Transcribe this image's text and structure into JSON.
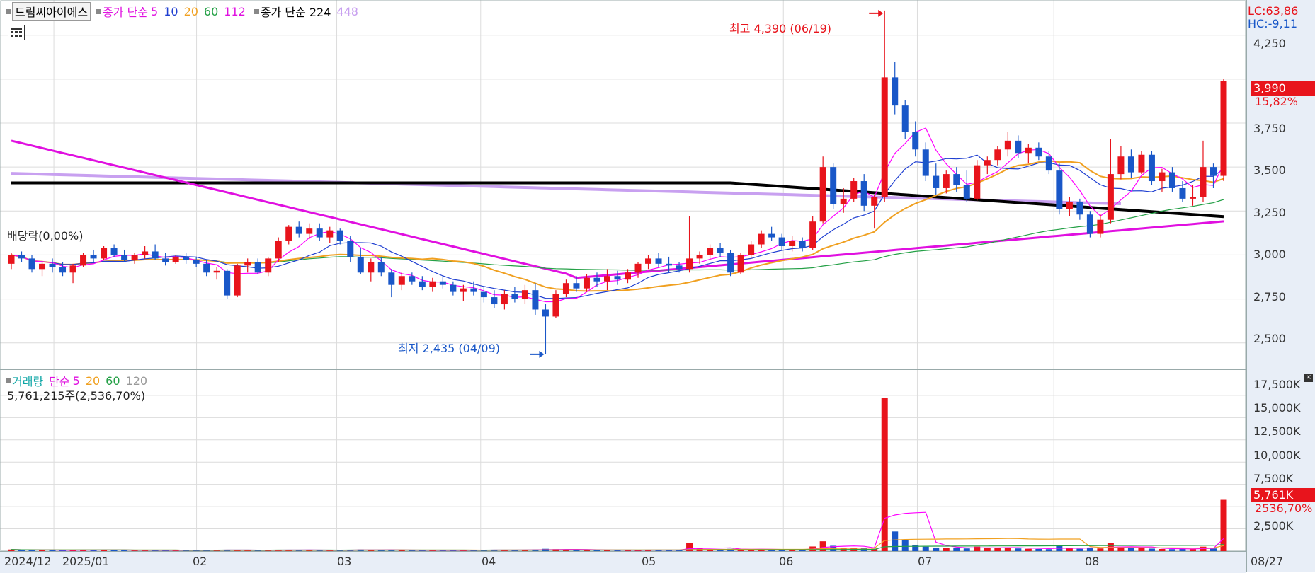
{
  "header": {
    "stock_name": "드림씨아이에스",
    "ma_label": "종가 단순",
    "ma_periods": [
      "5",
      "10",
      "20",
      "60",
      "112"
    ],
    "ma2_label": "종가 단순 224",
    "ma2_extra": "448",
    "lc": "LC:63,86",
    "hc": "HC:-9,11"
  },
  "annotations": {
    "high": "최고 4,390 (06/19)",
    "low": "최저 2,435 (04/09)",
    "dividend": "배당락(0,00%)",
    "price_tag": "3,990",
    "price_change": "15,82%",
    "volume_text": "5,761,215주(2,536,70%)",
    "vol_tag": "5,761K",
    "vol_change": "2536,70%"
  },
  "volume_legend": {
    "label": "거래량",
    "ma_label": "단순",
    "periods": [
      "5",
      "20",
      "60",
      "120"
    ]
  },
  "colors": {
    "up": "#e8141c",
    "down": "#1957c8",
    "ma5": "#ff00ff",
    "ma10": "#1f3fd1",
    "ma20": "#f0a020",
    "ma60": "#24a046",
    "ma112": "#e010e0",
    "ma224": "#000000",
    "ma448": "#c8a0f0"
  },
  "chart_data": {
    "type": "candlestick",
    "price_axis": {
      "ticks": [
        "4,250",
        "3,990",
        "3,750",
        "3,500",
        "3,250",
        "3,000",
        "2,750",
        "2,500"
      ],
      "range": [
        2350,
        4450
      ]
    },
    "volume_axis": {
      "ticks": [
        "17,500K",
        "15,000K",
        "12,500K",
        "10,000K",
        "7,500K",
        "5,761K",
        "2,500K"
      ],
      "range": [
        0,
        19000
      ]
    },
    "x_ticks": [
      "2024/12",
      "2025/01",
      "02",
      "03",
      "04",
      "05",
      "06",
      "07",
      "08",
      "08/27"
    ],
    "candles": [
      [
        2950,
        3010,
        2920,
        3000
      ],
      [
        3000,
        3020,
        2960,
        2980
      ],
      [
        2980,
        3000,
        2900,
        2920
      ],
      [
        2920,
        2960,
        2880,
        2950
      ],
      [
        2950,
        2980,
        2900,
        2930
      ],
      [
        2930,
        2960,
        2880,
        2900
      ],
      [
        2900,
        2950,
        2840,
        2940
      ],
      [
        2940,
        3010,
        2930,
        3000
      ],
      [
        3000,
        3030,
        2960,
        2980
      ],
      [
        2980,
        3050,
        2970,
        3040
      ],
      [
        3040,
        3060,
        2990,
        3000
      ],
      [
        3000,
        3030,
        2960,
        2970
      ],
      [
        2970,
        3010,
        2950,
        3000
      ],
      [
        3000,
        3050,
        2980,
        3020
      ],
      [
        3020,
        3060,
        2970,
        2980
      ],
      [
        2980,
        3010,
        2940,
        2960
      ],
      [
        2960,
        3000,
        2950,
        2990
      ],
      [
        2990,
        3010,
        2950,
        2970
      ],
      [
        2970,
        2990,
        2930,
        2950
      ],
      [
        2950,
        2970,
        2880,
        2900
      ],
      [
        2900,
        2930,
        2860,
        2910
      ],
      [
        2910,
        2920,
        2750,
        2770
      ],
      [
        2770,
        2950,
        2760,
        2940
      ],
      [
        2940,
        2980,
        2900,
        2960
      ],
      [
        2960,
        2980,
        2890,
        2900
      ],
      [
        2900,
        2990,
        2880,
        2980
      ],
      [
        2980,
        3100,
        2960,
        3080
      ],
      [
        3080,
        3170,
        3060,
        3160
      ],
      [
        3160,
        3190,
        3100,
        3120
      ],
      [
        3120,
        3180,
        3090,
        3150
      ],
      [
        3150,
        3180,
        3080,
        3100
      ],
      [
        3100,
        3160,
        3070,
        3140
      ],
      [
        3140,
        3150,
        3060,
        3080
      ],
      [
        3080,
        3110,
        2960,
        2990
      ],
      [
        2990,
        3040,
        2890,
        2900
      ],
      [
        2900,
        2980,
        2850,
        2960
      ],
      [
        2960,
        2990,
        2880,
        2900
      ],
      [
        2900,
        2920,
        2760,
        2830
      ],
      [
        2830,
        2900,
        2800,
        2880
      ],
      [
        2880,
        2900,
        2830,
        2850
      ],
      [
        2850,
        2880,
        2800,
        2820
      ],
      [
        2820,
        2870,
        2790,
        2850
      ],
      [
        2850,
        2880,
        2810,
        2830
      ],
      [
        2830,
        2850,
        2770,
        2790
      ],
      [
        2790,
        2830,
        2740,
        2810
      ],
      [
        2810,
        2850,
        2770,
        2790
      ],
      [
        2790,
        2820,
        2730,
        2760
      ],
      [
        2760,
        2800,
        2700,
        2720
      ],
      [
        2720,
        2800,
        2690,
        2780
      ],
      [
        2780,
        2820,
        2730,
        2750
      ],
      [
        2750,
        2830,
        2720,
        2800
      ],
      [
        2800,
        2840,
        2660,
        2690
      ],
      [
        2690,
        2720,
        2435,
        2650
      ],
      [
        2650,
        2800,
        2640,
        2780
      ],
      [
        2780,
        2860,
        2760,
        2840
      ],
      [
        2840,
        2880,
        2790,
        2810
      ],
      [
        2810,
        2890,
        2790,
        2870
      ],
      [
        2870,
        2900,
        2820,
        2850
      ],
      [
        2850,
        2920,
        2800,
        2880
      ],
      [
        2880,
        2910,
        2830,
        2860
      ],
      [
        2860,
        2920,
        2840,
        2900
      ],
      [
        2900,
        2960,
        2870,
        2950
      ],
      [
        2950,
        3000,
        2920,
        2980
      ],
      [
        2980,
        3010,
        2930,
        2950
      ],
      [
        2950,
        2990,
        2900,
        2940
      ],
      [
        2940,
        2960,
        2900,
        2920
      ],
      [
        2920,
        3220,
        2900,
        2980
      ],
      [
        2980,
        3020,
        2950,
        3000
      ],
      [
        3000,
        3060,
        2970,
        3040
      ],
      [
        3040,
        3070,
        2990,
        3010
      ],
      [
        3010,
        3030,
        2880,
        2900
      ],
      [
        2900,
        3010,
        2890,
        3000
      ],
      [
        3000,
        3080,
        2980,
        3060
      ],
      [
        3060,
        3140,
        3040,
        3120
      ],
      [
        3120,
        3160,
        3080,
        3100
      ],
      [
        3100,
        3120,
        3030,
        3050
      ],
      [
        3050,
        3110,
        3020,
        3080
      ],
      [
        3080,
        3100,
        3020,
        3040
      ],
      [
        3040,
        3220,
        3030,
        3190
      ],
      [
        3190,
        3560,
        3180,
        3500
      ],
      [
        3500,
        3520,
        3260,
        3290
      ],
      [
        3290,
        3380,
        3240,
        3320
      ],
      [
        3320,
        3440,
        3300,
        3420
      ],
      [
        3420,
        3460,
        3250,
        3280
      ],
      [
        3280,
        3340,
        3150,
        3330
      ],
      [
        3330,
        4390,
        3300,
        4010
      ],
      [
        4010,
        4100,
        3800,
        3850
      ],
      [
        3850,
        3880,
        3660,
        3700
      ],
      [
        3700,
        3760,
        3560,
        3600
      ],
      [
        3600,
        3640,
        3420,
        3450
      ],
      [
        3450,
        3520,
        3340,
        3380
      ],
      [
        3380,
        3480,
        3350,
        3460
      ],
      [
        3460,
        3500,
        3360,
        3400
      ],
      [
        3400,
        3480,
        3300,
        3320
      ],
      [
        3320,
        3540,
        3310,
        3510
      ],
      [
        3510,
        3560,
        3460,
        3540
      ],
      [
        3540,
        3620,
        3510,
        3600
      ],
      [
        3600,
        3700,
        3560,
        3650
      ],
      [
        3650,
        3680,
        3550,
        3580
      ],
      [
        3580,
        3630,
        3520,
        3610
      ],
      [
        3610,
        3640,
        3540,
        3560
      ],
      [
        3560,
        3590,
        3460,
        3480
      ],
      [
        3480,
        3520,
        3230,
        3260
      ],
      [
        3260,
        3330,
        3220,
        3300
      ],
      [
        3300,
        3320,
        3200,
        3230
      ],
      [
        3230,
        3250,
        3100,
        3120
      ],
      [
        3120,
        3230,
        3100,
        3200
      ],
      [
        3200,
        3660,
        3180,
        3460
      ],
      [
        3460,
        3620,
        3430,
        3560
      ],
      [
        3560,
        3600,
        3440,
        3470
      ],
      [
        3470,
        3590,
        3460,
        3570
      ],
      [
        3570,
        3590,
        3400,
        3420
      ],
      [
        3420,
        3490,
        3360,
        3470
      ],
      [
        3470,
        3500,
        3360,
        3380
      ],
      [
        3380,
        3420,
        3300,
        3320
      ],
      [
        3320,
        3400,
        3280,
        3330
      ],
      [
        3330,
        3650,
        3300,
        3500
      ],
      [
        3500,
        3520,
        3380,
        3450
      ],
      [
        3450,
        4000,
        3420,
        3990
      ]
    ],
    "volumes": [
      180,
      120,
      140,
      100,
      90,
      110,
      130,
      160,
      100,
      150,
      120,
      90,
      100,
      110,
      100,
      90,
      80,
      100,
      90,
      120,
      140,
      160,
      100,
      90,
      80,
      130,
      160,
      140,
      100,
      120,
      90,
      110,
      100,
      150,
      180,
      120,
      100,
      160,
      120,
      90,
      80,
      100,
      90,
      110,
      100,
      90,
      120,
      160,
      140,
      100,
      130,
      180,
      260,
      220,
      160,
      120,
      140,
      110,
      120,
      100,
      110,
      130,
      150,
      120,
      100,
      90,
      900,
      300,
      200,
      220,
      260,
      180,
      200,
      240,
      180,
      160,
      150,
      140,
      520,
      1100,
      600,
      380,
      300,
      320,
      260,
      17200,
      2200,
      1200,
      700,
      500,
      400,
      360,
      320,
      300,
      500,
      380,
      360,
      420,
      300,
      260,
      240,
      220,
      600,
      320,
      260,
      400,
      300,
      900,
      500,
      320,
      340,
      280,
      240,
      220,
      260,
      220,
      500,
      300,
      5761
    ]
  }
}
